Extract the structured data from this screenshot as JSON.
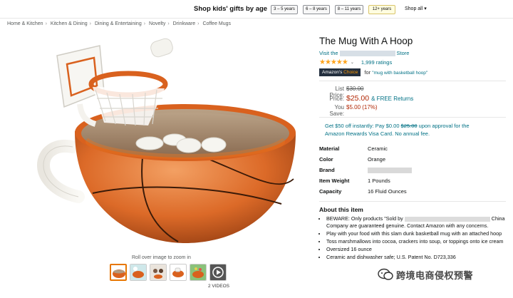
{
  "banner": {
    "title": "Shop kids' gifts by age",
    "ages": [
      "3 – 5 years",
      "6 – 8 years",
      "8 – 11 years",
      "12+ years"
    ],
    "shop_all": "Shop all ▾"
  },
  "breadcrumb": [
    "Home & Kitchen",
    "Kitchen & Dining",
    "Dining & Entertaining",
    "Novelty",
    "Drinkware",
    "Coffee Mugs"
  ],
  "breadcrumb_sep": "›",
  "gallery": {
    "zoom_hint": "Roll over image to zoom in",
    "videos_label": "2 VIDEOS",
    "thumb_icons": [
      "mug-thumb-icon",
      "mug-toss-thumb-icon",
      "kids-thumb-icon",
      "marshmallow-thumb-icon",
      "cereal-thumb-icon",
      "video-play-icon"
    ]
  },
  "product": {
    "title": "The Mug With A Hoop",
    "visit_prefix": "Visit the",
    "visit_suffix": "Store",
    "stars": "★★★★★",
    "star_chevron": "⌄",
    "ratings": "1,999 ratings",
    "choice_amazons": "Amazon's",
    "choice_word": "Choice",
    "for_label": "for",
    "for_query": "\"mug with basketball hoop\""
  },
  "price": {
    "list_label": "List Price:",
    "list_value": "$30.00",
    "price_label": "Price:",
    "price_value": "$25.00",
    "returns": "& FREE Returns",
    "save_label": "You Save:",
    "save_value": "$5.00 (17%)"
  },
  "promo": {
    "line1_a": "Get $50 off instantly: Pay $0.00",
    "line1_strike": "$25.00",
    "line1_b": "upon approval for the",
    "line2": "Amazon Rewards Visa Card. No annual fee."
  },
  "specs": [
    {
      "key": "Material",
      "value": "Ceramic"
    },
    {
      "key": "Color",
      "value": "Orange"
    },
    {
      "key": "Brand",
      "value": ""
    },
    {
      "key": "Item Weight",
      "value": "1 Pounds"
    },
    {
      "key": "Capacity",
      "value": "16 Fluid Ounces"
    }
  ],
  "about": {
    "title": "About this item",
    "b1_a": "BEWARE: Only products \"Sold by",
    "b1_b": "China Company are guaranteed genuine. Contact Amazon with any concerns.",
    "b2": "Play with your food with this slam dunk basketball mug with an attached hoop",
    "b3": "Toss marshmallows into cocoa, crackers into soup, or toppings onto ice cream",
    "b4": "Oversized 16 ounce",
    "b5": "Ceramic and dishwasher safe; U.S. Patent No. D723,336"
  },
  "watermark": "跨境电商侵权预警",
  "colors": {
    "accent": "#e77600",
    "link": "#007185",
    "price": "#b12704",
    "mug": "#d9611e"
  }
}
